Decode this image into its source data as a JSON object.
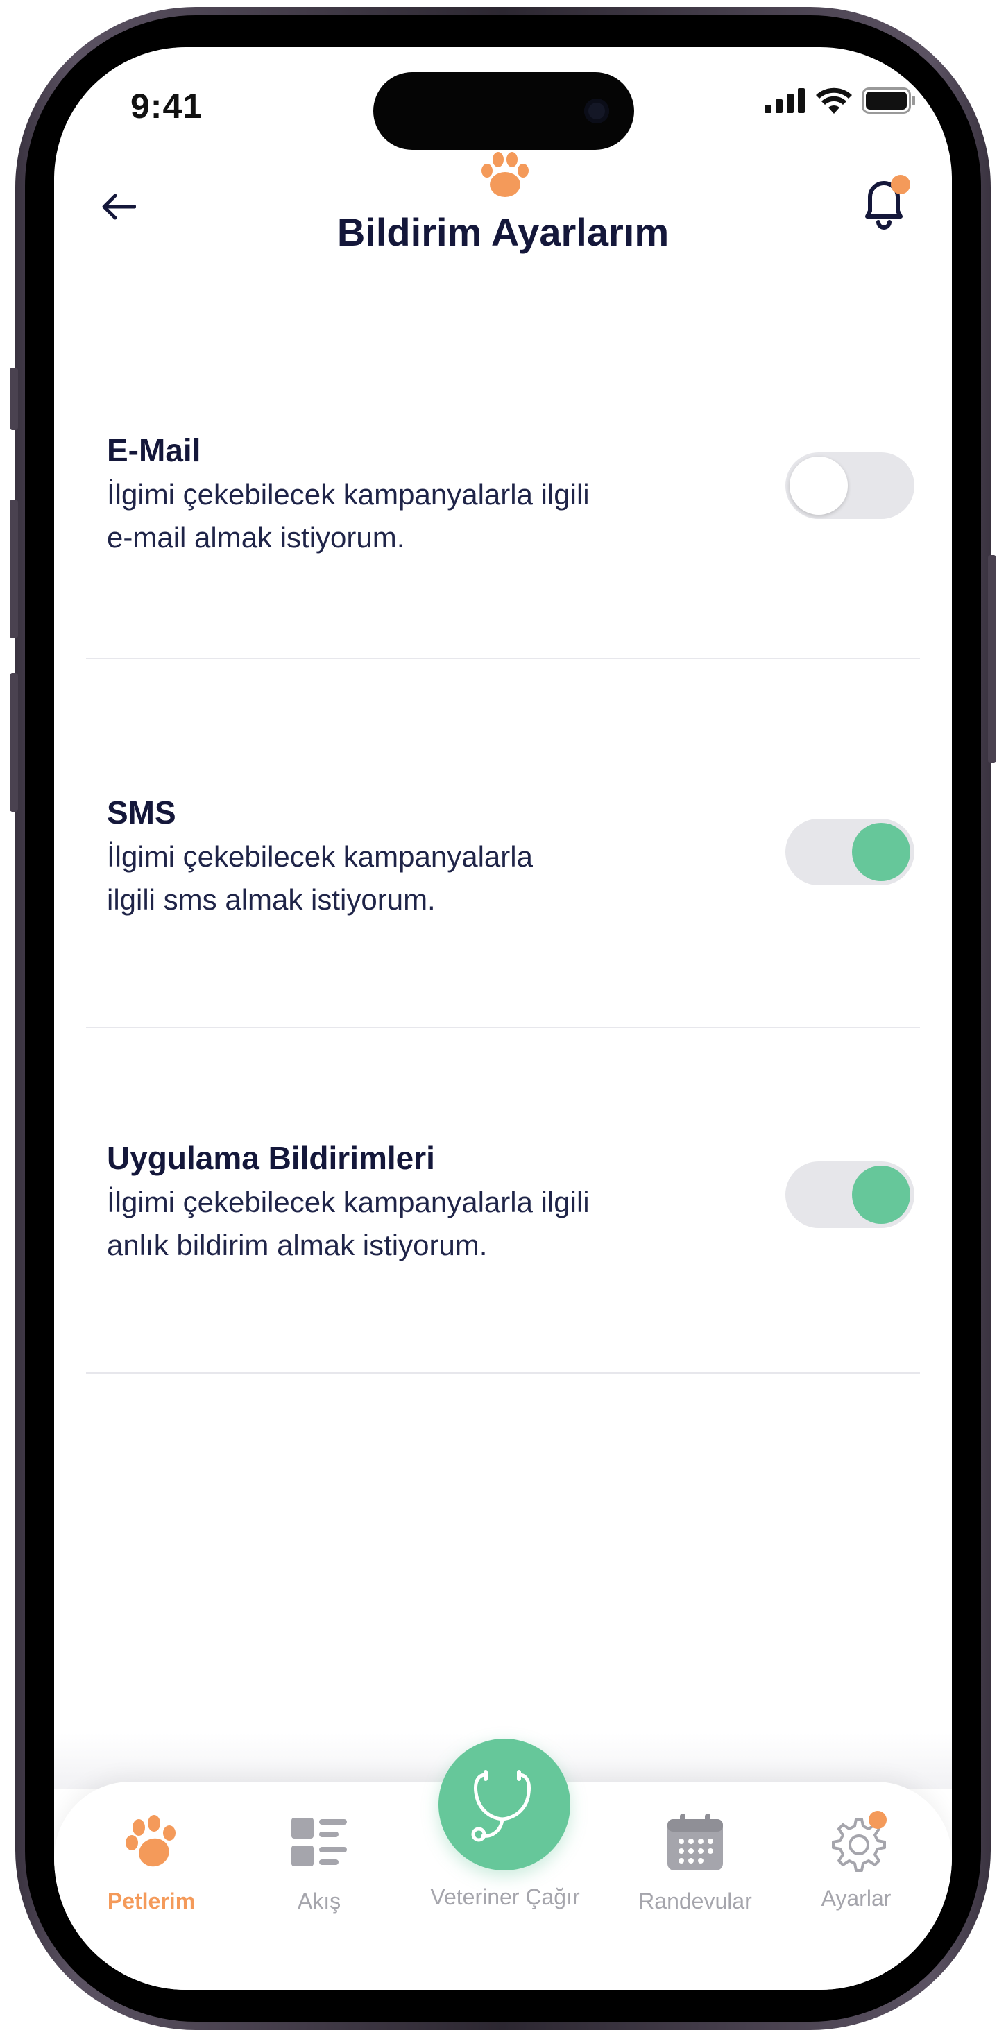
{
  "status_bar": {
    "time": "9:41",
    "icons": [
      "signal-icon",
      "wifi-icon",
      "battery-icon"
    ]
  },
  "header": {
    "title": "Bildirim Ayarlarım",
    "back_icon": "back-arrow-icon",
    "logo_icon": "paw-icon",
    "notification_icon": "bell-icon",
    "has_unread": true
  },
  "settings": [
    {
      "title": "E-Mail",
      "description_line1": "İlgimi çekebilecek kampanyalarla ilgili",
      "description_line2": "e-mail almak istiyorum.",
      "enabled": false
    },
    {
      "title": "SMS",
      "description_line1": "İlgimi çekebilecek kampanyalarla",
      "description_line2": "ilgili sms almak istiyorum.",
      "enabled": true
    },
    {
      "title": "Uygulama Bildirimleri",
      "description_line1": "İlgimi çekebilecek kampanyalarla ilgili",
      "description_line2": "anlık bildirim almak istiyorum.",
      "enabled": true
    }
  ],
  "bottom_nav": {
    "items": [
      {
        "label": "Petlerim",
        "icon": "paw-icon",
        "active": true
      },
      {
        "label": "Akış",
        "icon": "feed-icon",
        "active": false
      },
      {
        "label": "Veteriner Çağır",
        "icon": "stethoscope-icon",
        "active": false
      },
      {
        "label": "Randevular",
        "icon": "calendar-icon",
        "active": false
      },
      {
        "label": "Ayarlar",
        "icon": "gear-icon",
        "active": false,
        "badge": true
      }
    ]
  },
  "colors": {
    "accent_orange": "#f49a5a",
    "accent_green": "#66c79a",
    "title_navy": "#14173a",
    "muted_gray": "#a5a5ac"
  }
}
